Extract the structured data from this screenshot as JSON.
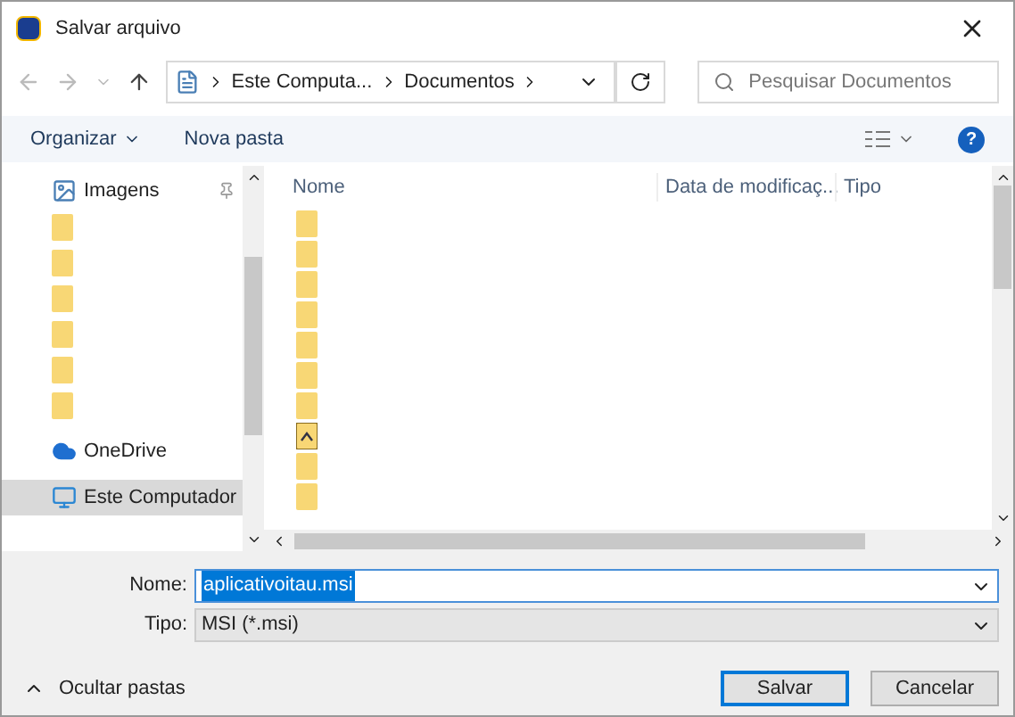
{
  "window": {
    "title": "Salvar arquivo"
  },
  "address_bar": {
    "crumbs": [
      "Este Computa...",
      "Documentos"
    ],
    "search_placeholder": "Pesquisar Documentos"
  },
  "toolbar": {
    "organize": "Organizar",
    "new_folder": "Nova pasta",
    "help": "?"
  },
  "nav": [
    {
      "kind": "pictures",
      "label": "Imagens",
      "pinned": true,
      "selected": false
    },
    {
      "kind": "folder",
      "selected": false
    },
    {
      "kind": "folder",
      "selected": false
    },
    {
      "kind": "folder",
      "selected": false
    },
    {
      "kind": "folder",
      "selected": false
    },
    {
      "kind": "folder",
      "selected": false
    },
    {
      "kind": "folder",
      "selected": false
    },
    {
      "kind": "cloud",
      "label": "OneDrive",
      "selected": false
    },
    {
      "kind": "computer",
      "label": "Este Computador",
      "selected": true
    }
  ],
  "columns": [
    "Nome",
    "Data de modificaç...",
    "Tipo"
  ],
  "files": [
    {
      "kind": "folder"
    },
    {
      "kind": "folder"
    },
    {
      "kind": "folder"
    },
    {
      "kind": "folder"
    },
    {
      "kind": "folder"
    },
    {
      "kind": "folder"
    },
    {
      "kind": "folder"
    },
    {
      "kind": "special"
    },
    {
      "kind": "folder"
    },
    {
      "kind": "folder"
    }
  ],
  "form": {
    "name_label": "Nome:",
    "name_value": "aplicativoitau.msi",
    "type_label": "Tipo:",
    "type_value": "MSI (*.msi)"
  },
  "hide_folders": "Ocultar pastas",
  "buttons": [
    {
      "label": "Salvar",
      "default": true
    },
    {
      "label": "Cancelar",
      "default": false
    }
  ]
}
